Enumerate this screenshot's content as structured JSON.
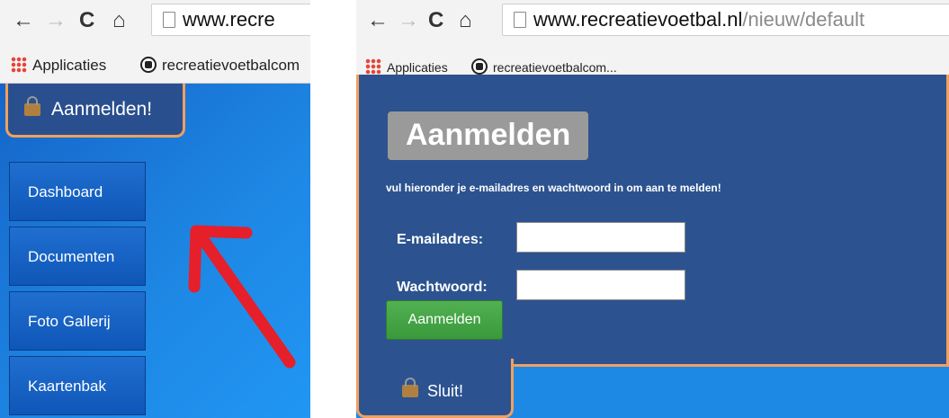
{
  "left": {
    "url_visible": "www.recre",
    "bookmarks": [
      {
        "label": "Applicaties",
        "icon": "apps-grid-icon"
      },
      {
        "label": "recreatievoetbalcom",
        "icon": "soccer-ball-icon"
      }
    ],
    "login_tab_label": "Aanmelden!",
    "sidebar": [
      {
        "label": "Dashboard"
      },
      {
        "label": "Documenten"
      },
      {
        "label": "Foto Gallerij"
      },
      {
        "label": "Kaartenbak"
      }
    ]
  },
  "right": {
    "url": {
      "domain": "www.recreatievoetbal.nl",
      "path": "/nieuw/default"
    },
    "bookmarks": [
      {
        "label": "Applicaties",
        "icon": "apps-grid-icon"
      },
      {
        "label": "recreatievoetbalcom...",
        "icon": "soccer-ball-icon"
      }
    ],
    "login": {
      "title": "Aanmelden",
      "intro": "vul hieronder je e-mailadres en wachtwoord in om aan te melden!",
      "email_label": "E-mailadres:",
      "email_value": "",
      "password_label": "Wachtwoord:",
      "password_value": "",
      "submit_label": "Aanmelden",
      "close_label": "Sluit!"
    }
  },
  "colors": {
    "panel_blue": "#2c5390",
    "page_blue": "#1e88e5",
    "accent_orange": "#f0a060",
    "button_green": "#3a993b",
    "title_gray": "#9a9a9a",
    "arrow_red": "#e5202a"
  },
  "icons": [
    "back-icon",
    "forward-icon",
    "reload-icon",
    "home-icon",
    "page-icon",
    "lock-icon"
  ]
}
